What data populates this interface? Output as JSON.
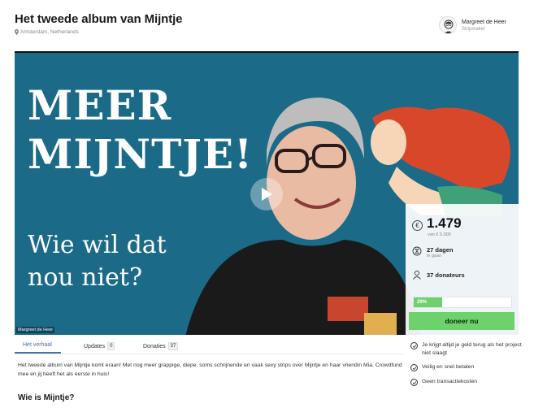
{
  "header": {
    "title": "Het tweede album van Mijntje",
    "location": "Amsterdam, Netherlands",
    "author_name": "Margreet de Heer",
    "author_role": "Stripmaker"
  },
  "video": {
    "line1": "MEER",
    "line2": "MIJNTJE!",
    "line3": "Wie wil dat",
    "line4": "nou niet?",
    "caption": "Margreet de Heer"
  },
  "stats": {
    "amount": "1.479",
    "goal": "van € 5.000",
    "days_value": "27 dagen",
    "days_label": "te gaan",
    "donors": "37 donateurs",
    "progress_label": "29%",
    "progress_fraction": 0.29,
    "donate_label": "doneer nu",
    "accent_color": "#6dd26b"
  },
  "tabs": [
    {
      "label": "Het verhaal",
      "count": ""
    },
    {
      "label": "Updates",
      "count": "0"
    },
    {
      "label": "Donaties",
      "count": "37"
    }
  ],
  "story": {
    "text": "Het tweede album van Mijntje komt eraan! Met nog meer grappige, diepe, soms schrijnende en vaak sexy strips over Mijntje en haar vriendin Mia. Crowdfund mee en jij heeft het als eerste in huis!",
    "subheading": "Wie is Mijntje?"
  },
  "benefits": [
    "Je krijgt altijd je geld terug als het project niet slaagt",
    "Veilig en snel betalen",
    "Geen transactiekosten"
  ]
}
